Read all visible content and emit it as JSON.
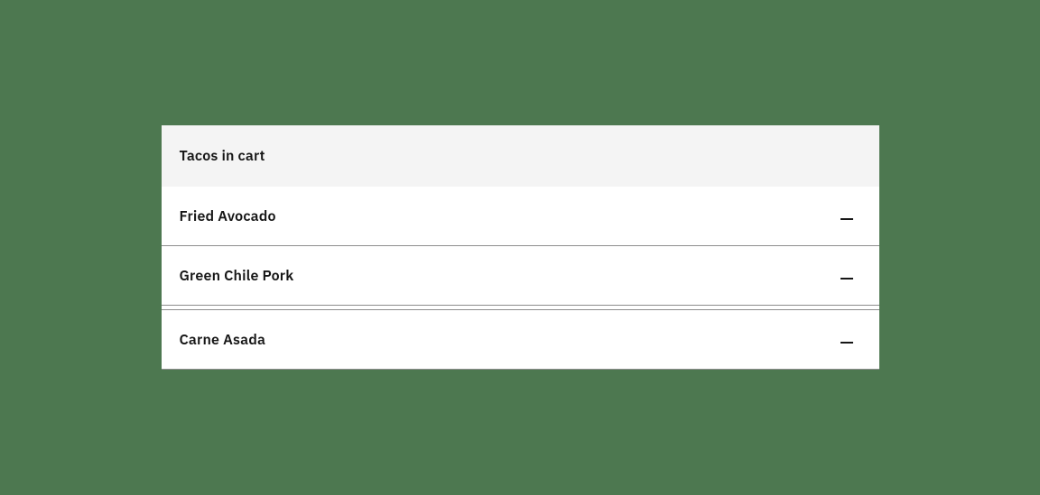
{
  "header": {
    "title": "Tacos in cart"
  },
  "cart": {
    "items": [
      {
        "name": "Fried Avocado"
      },
      {
        "name": "Green Chile Pork"
      },
      {
        "name": "Carne Asada"
      }
    ]
  }
}
